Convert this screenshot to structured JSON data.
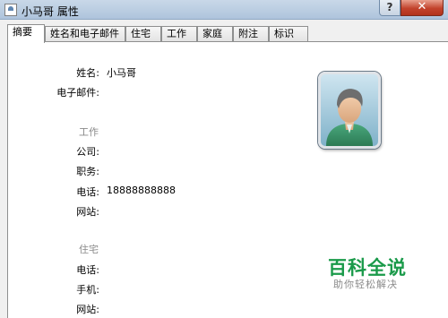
{
  "window": {
    "title": "小马哥 属性",
    "help_label": "?",
    "close_label": "✕"
  },
  "tabs": [
    {
      "label": "摘要",
      "active": true
    },
    {
      "label": "姓名和电子邮件"
    },
    {
      "label": "住宅"
    },
    {
      "label": "工作"
    },
    {
      "label": "家庭"
    },
    {
      "label": "附注"
    },
    {
      "label": "标识"
    }
  ],
  "summary": {
    "name_label": "姓名:",
    "name_value": "小马哥",
    "email_label": "电子邮件:",
    "work_section": "工作",
    "company_label": "公司:",
    "position_label": "职务:",
    "work_phone_label": "电话:",
    "work_phone_value": "18888888888",
    "work_website_label": "网站:",
    "home_section": "住宅",
    "home_phone_label": "电话:",
    "mobile_label": "手机:",
    "home_website_label": "网站:"
  },
  "watermark": {
    "brand": "百科全说",
    "slogan": "助你轻松解决"
  }
}
